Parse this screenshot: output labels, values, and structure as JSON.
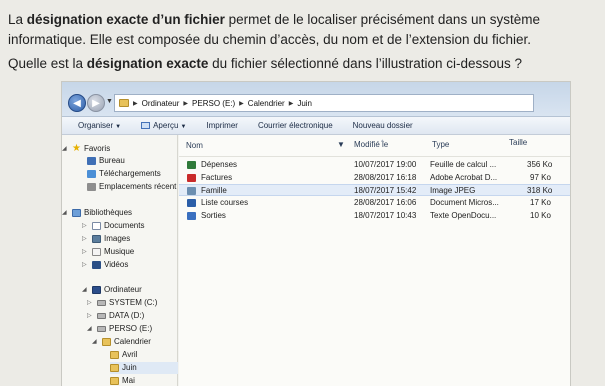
{
  "question": {
    "line1_pre": "La ",
    "line1_bold": "désignation exacte d’un fichier",
    "line1_post": " permet de le localiser précisément dans un système informatique. Elle est composée du chemin d’accès, du nom et de l’extension du fichier.",
    "line2_pre": "Quelle est la ",
    "line2_bold": "désignation exacte",
    "line2_post": " du fichier sélectionné dans l’illustration ci-dessous ?"
  },
  "address": {
    "crumbs": [
      "Ordinateur",
      "PERSO (E:)",
      "Calendrier",
      "Juin"
    ]
  },
  "toolbar": {
    "organiser": "Organiser",
    "apercu": "Aperçu",
    "imprimer": "Imprimer",
    "courrier": "Courrier électronique",
    "nouveau": "Nouveau dossier"
  },
  "tree": {
    "favoris": "Favoris",
    "bureau": "Bureau",
    "telechargements": "Téléchargements",
    "emplacements": "Emplacements récent",
    "bibliotheques": "Bibliothèques",
    "documents": "Documents",
    "images": "Images",
    "musique": "Musique",
    "videos": "Vidéos",
    "ordinateur": "Ordinateur",
    "systeme": "SYSTEM (C:)",
    "data": "DATA (D:)",
    "perso": "PERSO (E:)",
    "calendrier": "Calendrier",
    "avril": "Avril",
    "juin": "Juin",
    "mai": "Mai"
  },
  "columns": {
    "nom": "Nom",
    "modifie": "Modifié le",
    "type": "Type",
    "taille": "Taille"
  },
  "files": [
    {
      "name": "Dépenses",
      "date": "10/07/2017 19:00",
      "type": "Feuille de calcul ...",
      "size": "356 Ko",
      "icon": "spreadsheet-icon"
    },
    {
      "name": "Factures",
      "date": "28/08/2017 16:18",
      "type": "Adobe Acrobat D...",
      "size": "97 Ko",
      "icon": "pdf-icon"
    },
    {
      "name": "Famille",
      "date": "18/07/2017 15:42",
      "type": "Image JPEG",
      "size": "318 Ko",
      "icon": "image-file-icon"
    },
    {
      "name": "Liste courses",
      "date": "28/08/2017 16:06",
      "type": "Document Micros...",
      "size": "17 Ko",
      "icon": "word-doc-icon"
    },
    {
      "name": "Sorties",
      "date": "18/07/2017 10:43",
      "type": "Texte OpenDocu...",
      "size": "10 Ko",
      "icon": "odt-doc-icon"
    }
  ]
}
